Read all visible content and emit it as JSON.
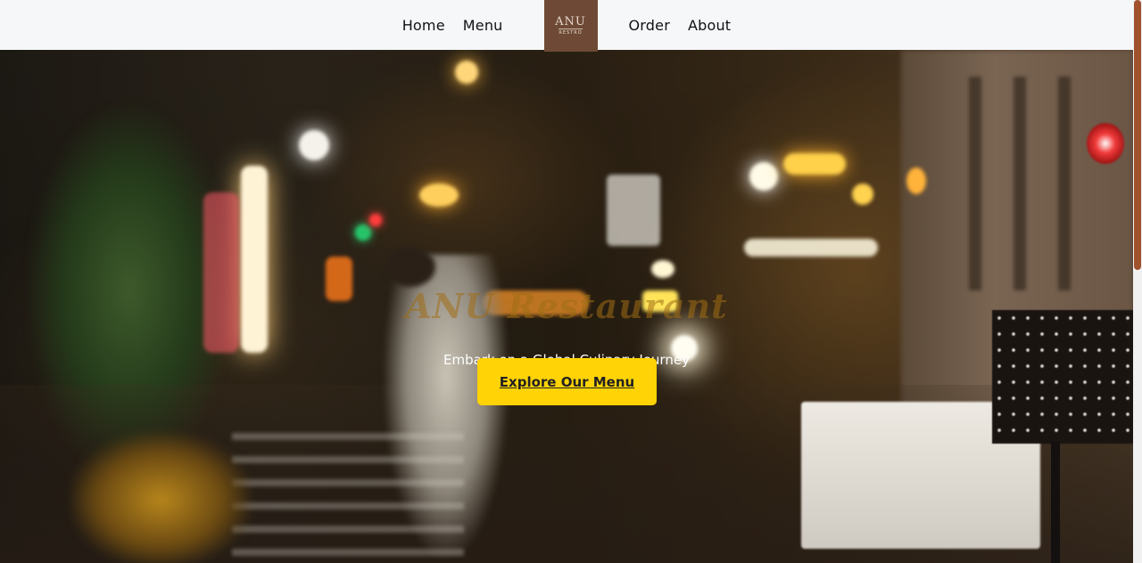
{
  "nav": {
    "left_links": [
      "Home",
      "Menu"
    ],
    "right_links": [
      "Order",
      "About"
    ],
    "logo": {
      "main": "ANU",
      "sub": "RESTRO"
    }
  },
  "hero": {
    "title": "ANU Restaurant",
    "tagline": "Embark on a Global Culinary Journey",
    "cta_label": "Explore Our Menu"
  },
  "colors": {
    "navbar_bg": "#f6f7f9",
    "logo_bg": "#6e4a36",
    "cta_bg": "#ffd305",
    "scroll_thumb": "#a0522d"
  },
  "scroll": {
    "thumb_fraction": 0.48
  }
}
